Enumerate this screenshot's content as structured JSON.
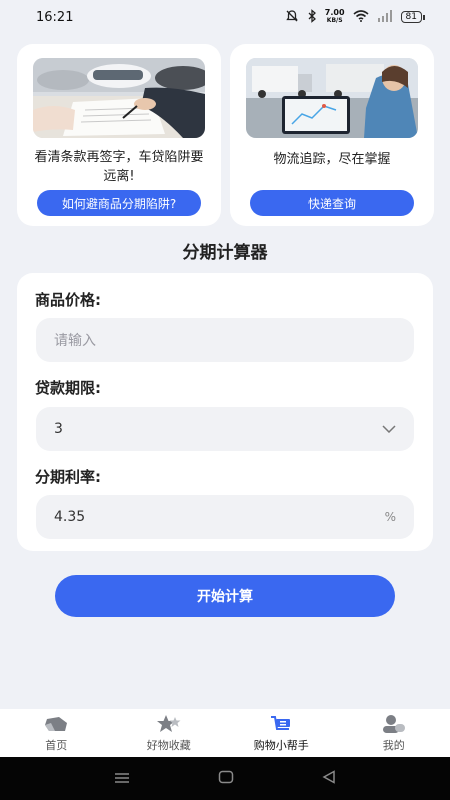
{
  "status": {
    "time": "16:21",
    "net_speed_value": "7.00",
    "net_speed_unit": "KB/S",
    "battery": "81"
  },
  "cards": [
    {
      "text": "看清条款再签字，车贷陷阱要远离!",
      "button": "如何避商品分期陷阱?"
    },
    {
      "text": "物流追踪，尽在掌握",
      "button": "快递查询"
    }
  ],
  "section_title": "分期计算器",
  "form": {
    "price_label": "商品价格:",
    "price_placeholder": "请输入",
    "term_label": "贷款期限:",
    "term_value": "3",
    "rate_label": "分期利率:",
    "rate_value": "4.35",
    "rate_unit": "%"
  },
  "start_button": "开始计算",
  "tabs": [
    {
      "label": "首页",
      "icon": "home-icon"
    },
    {
      "label": "好物收藏",
      "icon": "star-icon"
    },
    {
      "label": "购物小帮手",
      "icon": "cart-icon"
    },
    {
      "label": "我的",
      "icon": "user-icon"
    }
  ],
  "colors": {
    "accent": "#3a68f0",
    "background": "#eff1f6"
  }
}
